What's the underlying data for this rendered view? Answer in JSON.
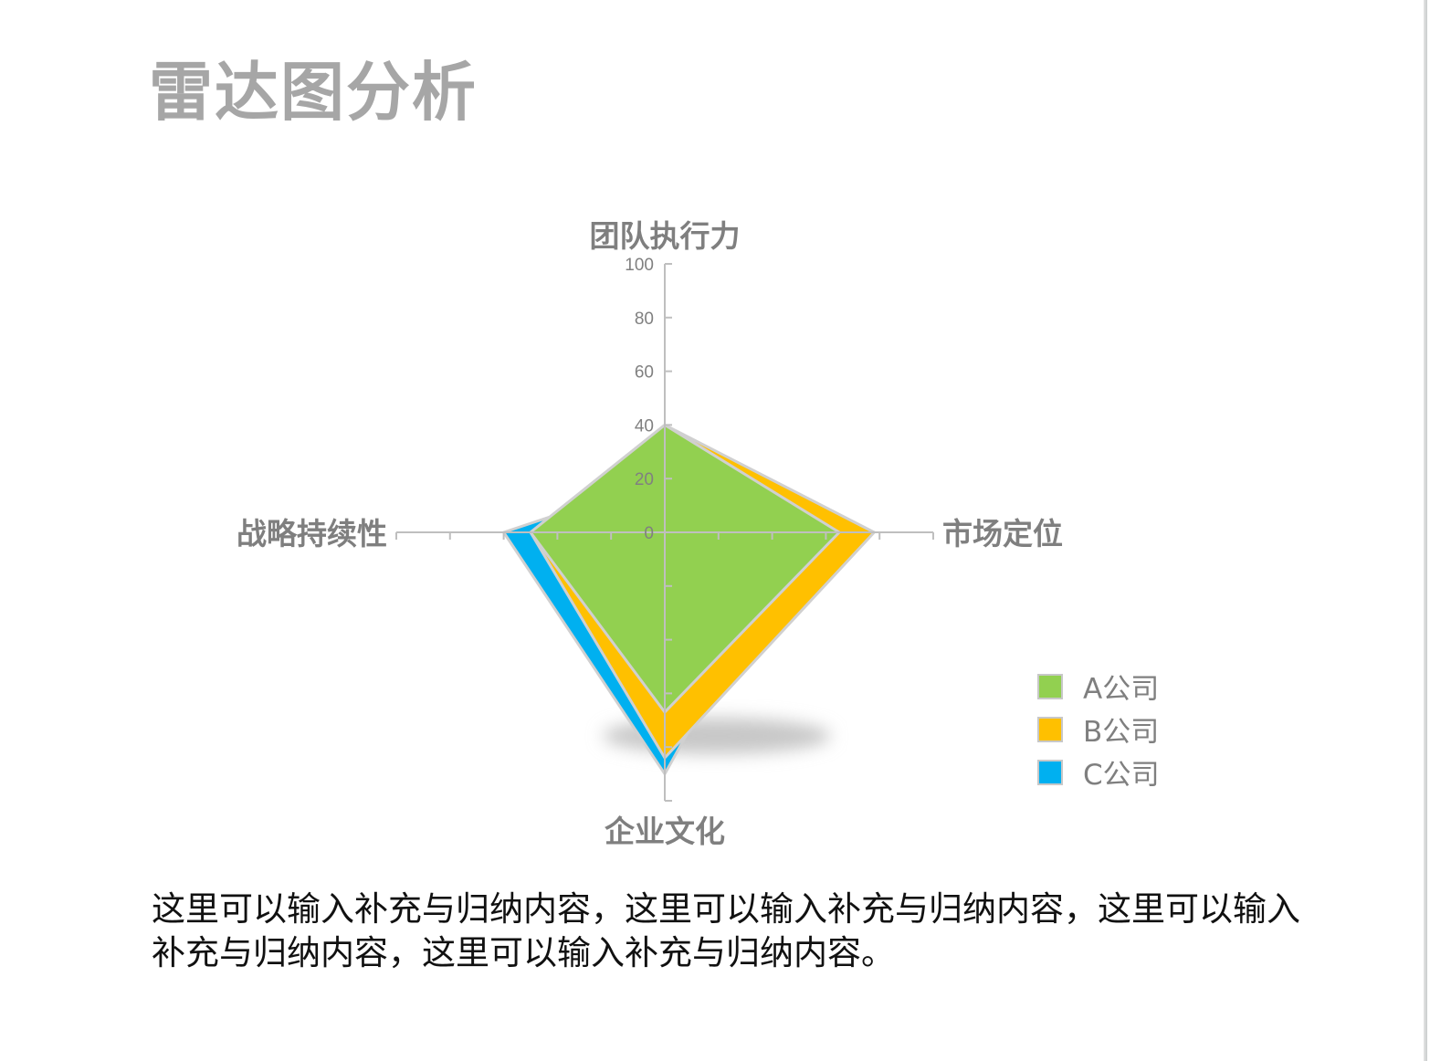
{
  "title": "雷达图分析",
  "body_text": "这里可以输入补充与归纳内容，这里可以输入补充与归纳内容，这里可以输入补充与归纳内容，这里可以输入补充与归纳内容。",
  "chart_data": {
    "type": "radar",
    "title": "",
    "categories": [
      "团队执行力",
      "市场定位",
      "企业文化",
      "战略持续性"
    ],
    "range": [
      0,
      100
    ],
    "ticks": [
      "0",
      "20",
      "40",
      "60",
      "80",
      "100"
    ],
    "series": [
      {
        "name": "C公司",
        "color": "#00b0f0",
        "values": [
          20,
          50,
          90,
          60
        ]
      },
      {
        "name": "B公司",
        "color": "#ffc000",
        "values": [
          40,
          78,
          84,
          50
        ]
      },
      {
        "name": "A公司",
        "color": "#92d050",
        "values": [
          40,
          65,
          67,
          50
        ]
      }
    ],
    "legend": {
      "position": "bottom-right",
      "items": [
        {
          "label": "A公司",
          "color": "#92d050"
        },
        {
          "label": "B公司",
          "color": "#ffc000"
        },
        {
          "label": "C公司",
          "color": "#00b0f0"
        }
      ]
    }
  }
}
